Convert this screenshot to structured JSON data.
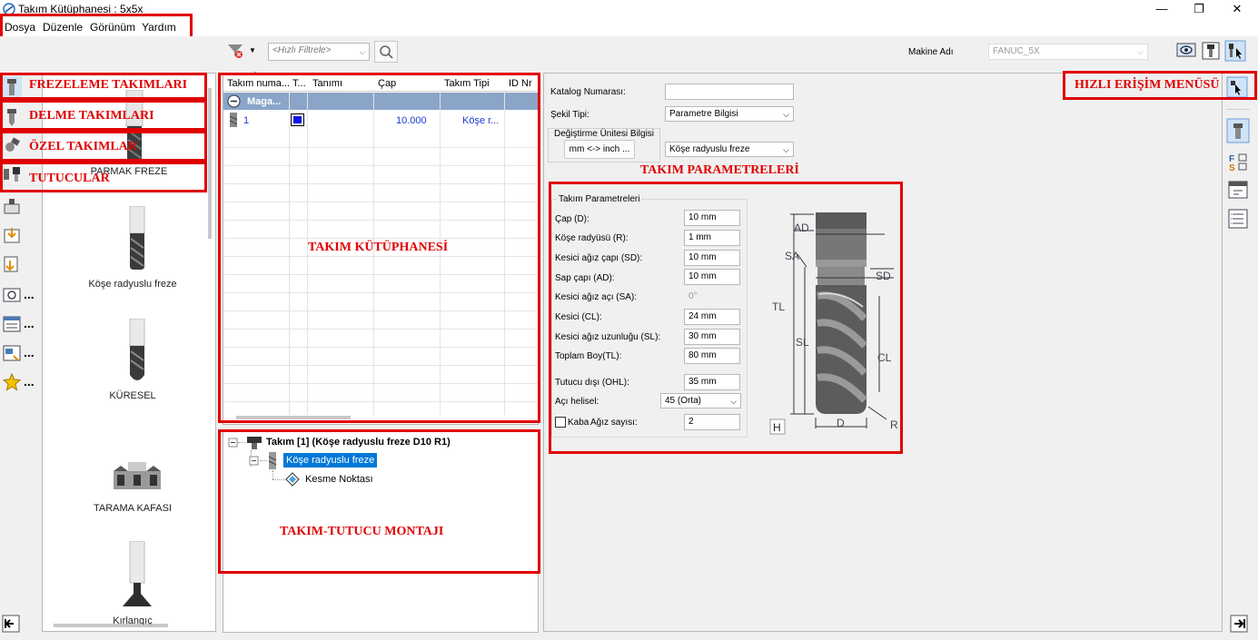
{
  "window": {
    "title": "Takım Kütüphanesi : 5x5x",
    "minimize": "—",
    "maximize": "❐",
    "close": "✕"
  },
  "menu": [
    "Dosya",
    "Düzenle",
    "Görünüm",
    "Yardım"
  ],
  "toolbar": {
    "filter_placeholder": "<Hızlı Filtrele>",
    "machine_label": "Makine Adı",
    "machine_value": "FANUC_5X"
  },
  "annotations": {
    "milling": "FREZELEME TAKIMLARI",
    "drilling": "DELME TAKIMLARI",
    "special": "ÖZEL TAKIMLAR",
    "holders": "TUTUCULAR",
    "library": "TAKIM KÜTÜPHANESİ",
    "assembly": "TAKIM-TUTUCU MONTAJI",
    "parameters": "TAKIM PARAMETRELERİ",
    "quick_access": "HIZLI ERİŞİM MENÜSÜ"
  },
  "side_toolbar": {
    "more": "..."
  },
  "tool_types": [
    "PARMAK FREZE",
    "Köşe radyuslu freze",
    "KÜRESEL",
    "TARAMA KAFASI",
    "Kırlangıç"
  ],
  "table": {
    "columns": [
      "Takım numa...",
      "T...",
      "Tanımı",
      "Çap",
      "Takım Tipi",
      "ID Nr"
    ],
    "group_row": "Maga...",
    "rows": [
      {
        "number": "1",
        "diameter": "10.000",
        "type": "Köşe r..."
      }
    ]
  },
  "tree": {
    "root": "Takım [1] (Köşe radyuslu freze D10 R1)",
    "child": "Köşe radyuslu freze",
    "grandchild": "Kesme Noktası"
  },
  "form": {
    "catalog_label": "Katalog Numarası:",
    "catalog_value": "",
    "shape_label": "Şekil Tipi:",
    "shape_value": "Parametre Bilgisi",
    "unit_group": "Değiştirme Ünitesi Bilgisi",
    "unit_button": "mm <-> inch ...",
    "tool_type_value": "Köşe radyuslu freze"
  },
  "params": {
    "group": "Takım Parametreleri",
    "fields": [
      {
        "label": "Çap (D):",
        "value": "10 mm"
      },
      {
        "label": "Köşe radyüsü (R):",
        "value": "1 mm"
      },
      {
        "label": "Kesici ağız çapı (SD):",
        "value": "10 mm"
      },
      {
        "label": "Sap çapı (AD):",
        "value": "10 mm"
      },
      {
        "label": "Kesici ağız açı (SA):",
        "value": "0°"
      },
      {
        "label": "Kesici (CL):",
        "value": "24 mm"
      },
      {
        "label": "Kesici ağız uzunluğu (SL):",
        "value": "30 mm"
      },
      {
        "label": "Toplam Boy(TL):",
        "value": "80 mm"
      }
    ],
    "ohl_label": "Tutucu dışı (OHL):",
    "ohl_value": "35 mm",
    "helix_label": "Açı helisel:",
    "helix_value": "45 (Orta)",
    "rough_label": "Kaba",
    "flutes_label": "Ağız sayısı:",
    "flutes_value": "2"
  },
  "diagram": {
    "AD": "AD",
    "SA": "SA",
    "SD": "SD",
    "TL": "TL",
    "SL": "SL",
    "CL": "CL",
    "D": "D",
    "R": "R",
    "H": "H"
  }
}
